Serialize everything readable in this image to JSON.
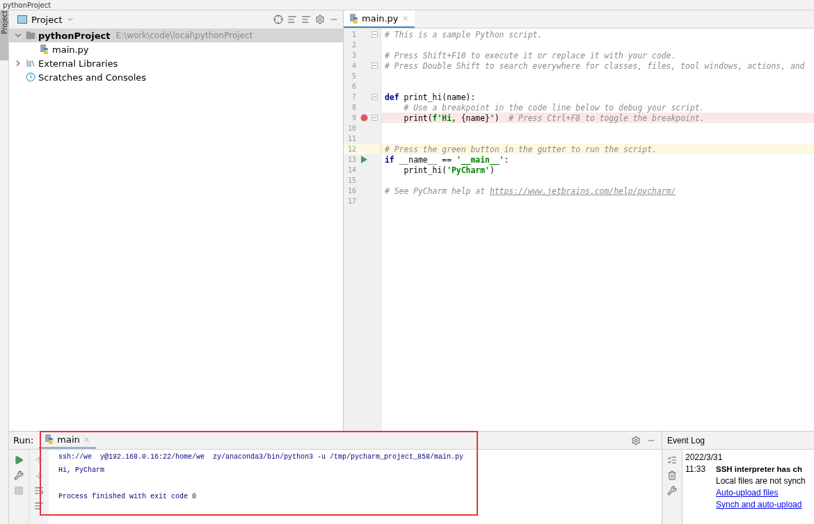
{
  "window": {
    "title": "pythonProject"
  },
  "side_tab": {
    "label": "Project",
    "selected": true
  },
  "project_panel": {
    "title": "Project",
    "tree": [
      {
        "label": "pythonProject",
        "path": "E:\\work\\code\\local\\pythonProject",
        "kind": "folder",
        "expanded": true,
        "selected": true,
        "children": [
          {
            "label": "main.py",
            "kind": "python",
            "selected": false
          }
        ]
      },
      {
        "label": "External Libraries",
        "kind": "library",
        "expanded": false,
        "selected": false
      },
      {
        "label": "Scratches and Consoles",
        "kind": "scratch",
        "selected": false
      }
    ]
  },
  "editor": {
    "tabs": [
      {
        "label": "main.py",
        "selected": true
      }
    ],
    "lines": [
      {
        "number": "1",
        "fold": true,
        "segments": [
          {
            "text": "# This is a sample Python script.",
            "kind": "comment"
          }
        ]
      },
      {
        "number": "2"
      },
      {
        "number": "3",
        "segments": [
          {
            "text": "# Press Shift+F10 to execute it or replace it with your code.",
            "kind": "comment"
          }
        ]
      },
      {
        "number": "4",
        "fold": true,
        "segments": [
          {
            "text": "# Press Double Shift to search everywhere for classes, files, tool windows, actions, and",
            "kind": "comment"
          }
        ]
      },
      {
        "number": "5"
      },
      {
        "number": "6"
      },
      {
        "number": "7",
        "fold": true,
        "segments": [
          {
            "text": "def",
            "kind": "keyword"
          },
          {
            "text": " print_hi(name):",
            "kind": "plain"
          }
        ]
      },
      {
        "number": "8",
        "segments": [
          {
            "text": "    # Use a breakpoint in the code line below to debug your script.",
            "kind": "comment"
          }
        ]
      },
      {
        "number": "9",
        "fold": true,
        "breakpoint": true,
        "segments": [
          {
            "text": "    print(",
            "kind": "plain"
          },
          {
            "text": "f'Hi, ",
            "kind": "string"
          },
          {
            "text": "{name}",
            "kind": "plain"
          },
          {
            "text": "'",
            "kind": "string"
          },
          {
            "text": ")  ",
            "kind": "plain"
          },
          {
            "text": "# Press Ctrl+F8 to toggle the breakpoint.",
            "kind": "comment"
          }
        ]
      },
      {
        "number": "10"
      },
      {
        "number": "11"
      },
      {
        "number": "12",
        "current": true,
        "segments": [
          {
            "text": "# Press the green button in the gutter to run the script.",
            "kind": "comment"
          }
        ]
      },
      {
        "number": "13",
        "run_marker": true,
        "segments": [
          {
            "text": "if",
            "kind": "keyword"
          },
          {
            "text": " __name__ == ",
            "kind": "plain"
          },
          {
            "text": "'__main__'",
            "kind": "string"
          },
          {
            "text": ":",
            "kind": "plain"
          }
        ]
      },
      {
        "number": "14",
        "segments": [
          {
            "text": "    print_hi(",
            "kind": "plain"
          },
          {
            "text": "'PyCharm'",
            "kind": "string"
          },
          {
            "text": ")",
            "kind": "plain"
          }
        ]
      },
      {
        "number": "15"
      },
      {
        "number": "16",
        "segments": [
          {
            "text": "# See PyCharm help at ",
            "kind": "comment"
          },
          {
            "text": "https://www.jetbrains.com/help/pycharm/",
            "kind": "link"
          }
        ]
      },
      {
        "number": "17"
      }
    ]
  },
  "run_panel": {
    "label": "Run:",
    "tabs": [
      {
        "label": "main",
        "selected": true
      }
    ],
    "console": [
      {
        "text": "ssh://we  y@192.168.0.16:22/home/we  zy/anaconda3/bin/python3 -u /tmp/pycharm_project_858/main.py"
      },
      {
        "text": "Hi, PyCharm"
      },
      {
        "text": "Process finished with exit code 0",
        "gap_before": true
      }
    ]
  },
  "event_log": {
    "title": "Event Log",
    "date": "2022/3/31",
    "time": "11:33",
    "heading": "SSH interpreter has ch",
    "message": "Local files are not synch",
    "links": [
      "Auto-upload files",
      "Synch and auto-upload"
    ]
  }
}
